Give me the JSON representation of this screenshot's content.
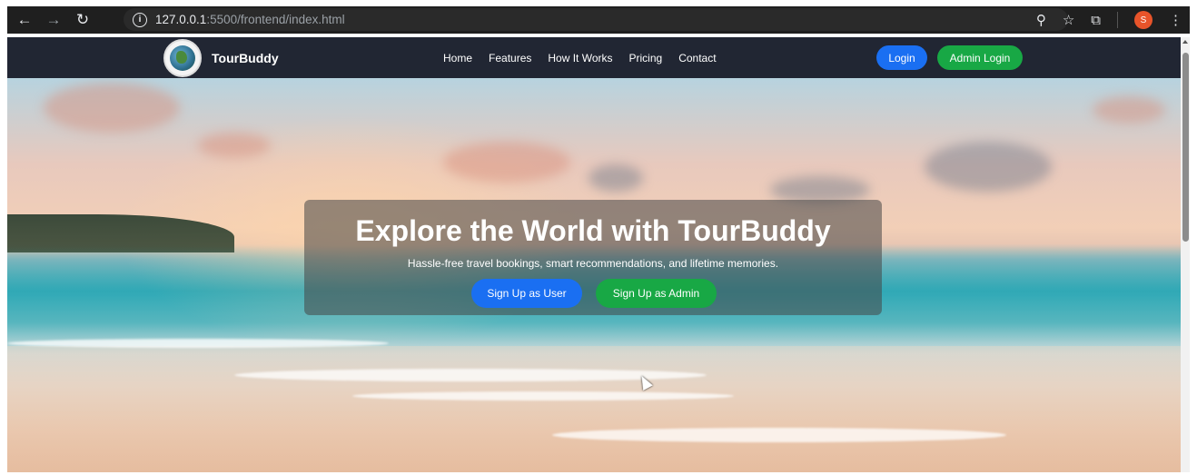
{
  "browser": {
    "url_host": "127.0.0.1",
    "url_path": ":5500/frontend/index.html",
    "avatar_letter": "S"
  },
  "icons": [
    "back-icon",
    "forward-icon",
    "reload-icon",
    "info-icon",
    "zoom-icon",
    "star-icon",
    "extensions-icon",
    "more-icon",
    "globe-logo-icon",
    "cursor-icon"
  ],
  "navbar": {
    "brand": "TourBuddy",
    "links": [
      "Home",
      "Features",
      "How It Works",
      "Pricing",
      "Contact"
    ],
    "login_label": "Login",
    "admin_login_label": "Admin Login"
  },
  "hero": {
    "title": "Explore the World with TourBuddy",
    "subtitle": "Hassle-free travel bookings, smart recommendations, and lifetime memories.",
    "signup_user_label": "Sign Up as User",
    "signup_admin_label": "Sign Up as Admin"
  },
  "colors": {
    "navbar_bg": "#212633",
    "primary_blue": "#1a6ff2",
    "success_green": "#18a845"
  }
}
